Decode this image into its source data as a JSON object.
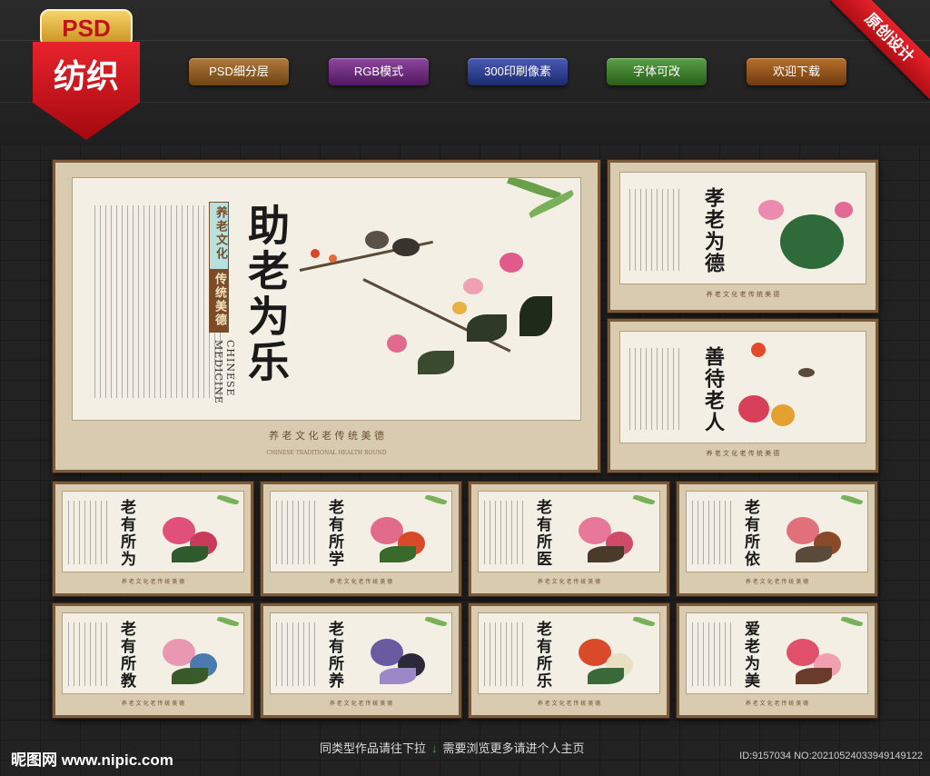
{
  "badge": {
    "top": "PSD",
    "main": "纺织"
  },
  "pills": [
    {
      "label": "PSD细分层",
      "color": "#8a5a24"
    },
    {
      "label": "RGB模式",
      "color": "#6a2a7a"
    },
    {
      "label": "300印刷像素",
      "color": "#2a3a8a"
    },
    {
      "label": "字体可改",
      "color": "#3a7a2a"
    },
    {
      "label": "欢迎下载",
      "color": "#8a4a1a"
    }
  ],
  "ribbon": "原创设计",
  "main_panel": {
    "title": "助老为乐",
    "subtitle_top": "养老文化",
    "subtitle_bottom": "传统美德",
    "english": "CHINESE MEDICINE",
    "footer": "养 老 文 化 老 传 统 美 德",
    "footer_sub": "CHINESE TRADITIONAL HEALTH ROUND"
  },
  "side_panels": [
    {
      "title": "孝老为德"
    },
    {
      "title": "善待老人"
    }
  ],
  "grid_panels": [
    {
      "title": "老有所为"
    },
    {
      "title": "老有所学"
    },
    {
      "title": "老有所医"
    },
    {
      "title": "老有所依"
    },
    {
      "title": "老有所教"
    },
    {
      "title": "老有所养"
    },
    {
      "title": "老有所乐"
    },
    {
      "title": "爱老为美"
    }
  ],
  "bottom": {
    "logo": "昵图网 www.nipic.com",
    "prompt_left": "同类型作品请往下拉",
    "prompt_right": "需要浏览更多请进个人主页",
    "id_text": "ID:9157034 NO:20210524033949149122"
  }
}
